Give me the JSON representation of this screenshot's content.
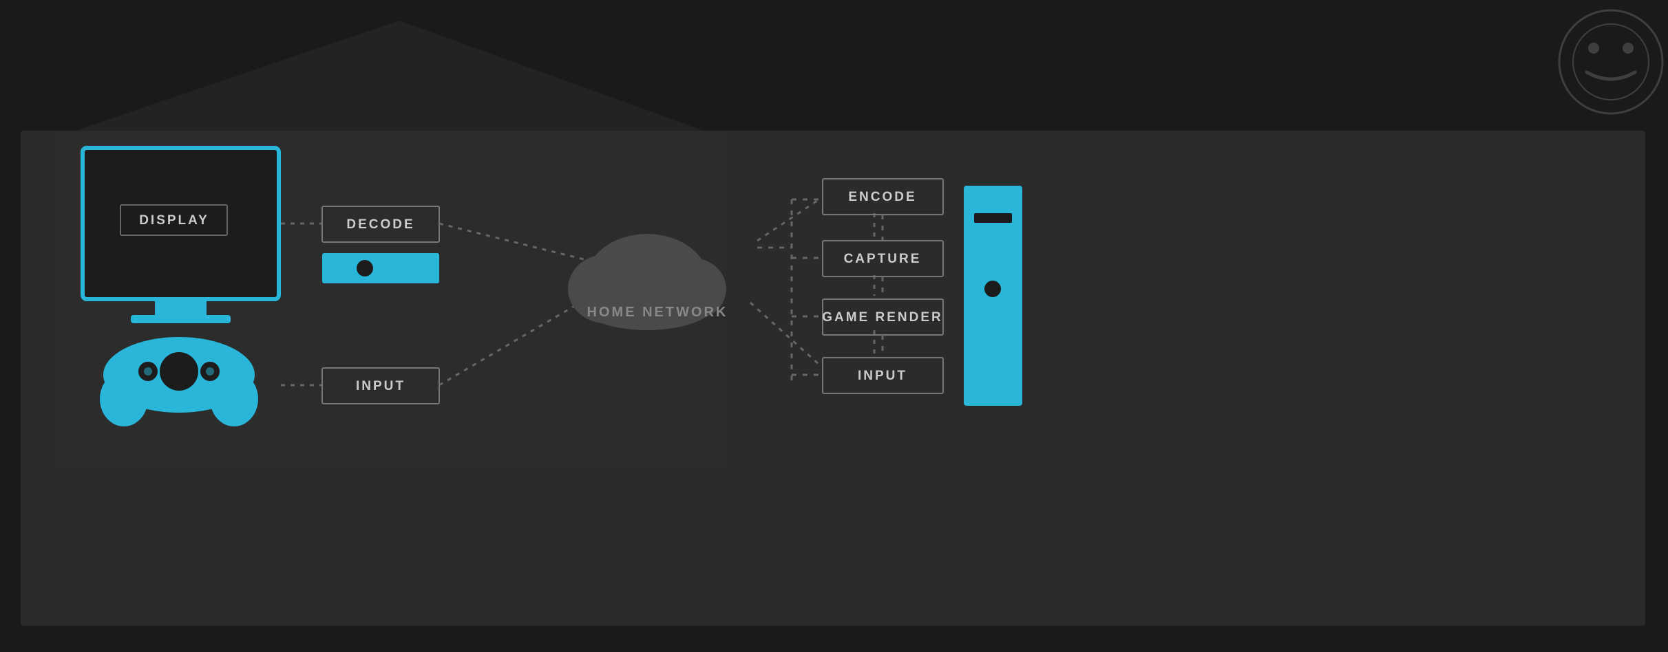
{
  "background": {
    "color": "#1a1a1a",
    "panel_color": "#2d2d2d"
  },
  "steam_logo": {
    "opacity": 0.35
  },
  "left_device": {
    "tv": {
      "label": "DISPLAY"
    },
    "controller": {
      "color": "#29b6d8"
    }
  },
  "middle_left_boxes": [
    {
      "label": "DECODE"
    },
    {
      "label": "INPUT"
    }
  ],
  "cloud": {
    "label": "HOME NETWORK"
  },
  "right_boxes": [
    {
      "label": "ENCODE"
    },
    {
      "label": "CAPTURE"
    },
    {
      "label": "GAME RENDER"
    },
    {
      "label": "INPUT"
    }
  ],
  "colors": {
    "cyan": "#29b6d8",
    "dark_bg": "#1c1c1c",
    "panel": "#2e2e2e",
    "box_border": "#666666",
    "text": "#cccccc",
    "dot_line": "#666666",
    "cloud_fill": "#555555",
    "label_text": "#888888"
  }
}
